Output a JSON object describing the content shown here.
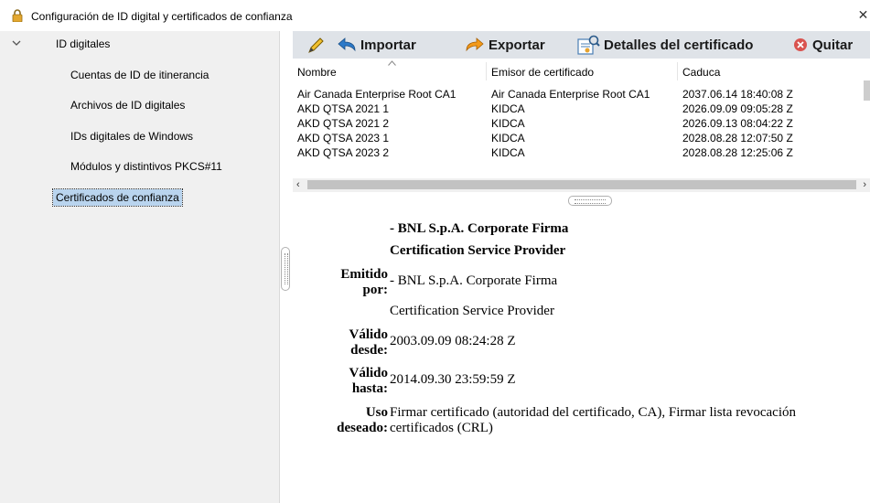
{
  "window": {
    "title": "Configuración de ID digital y certificados de confianza",
    "close_glyph": "✕",
    "icon": "lock-icon"
  },
  "sidebar": {
    "group": "ID digitales",
    "items": [
      "Cuentas de ID de itinerancia",
      "Archivos de ID digitales",
      "IDs digitales de Windows",
      "Módulos y distintivos PKCS#11"
    ],
    "selected": "Certificados de confianza"
  },
  "toolbar": {
    "import_label": "Importar",
    "export_label": "Exportar",
    "details_label": "Detalles del certificado",
    "remove_label": "Quitar"
  },
  "table": {
    "columns": [
      "Nombre",
      "Emisor de certificado",
      "Caduca"
    ],
    "rows": [
      [
        "Air Canada Enterprise Root CA1",
        "Air Canada Enterprise Root CA1",
        "2037.06.14 18:40:08 Z"
      ],
      [
        "AKD QTSA 2021 1",
        "KIDCA",
        "2026.09.09 09:05:28 Z"
      ],
      [
        "AKD QTSA 2021 2",
        "KIDCA",
        "2026.09.13 08:04:22 Z"
      ],
      [
        "AKD QTSA 2023 1",
        "KIDCA",
        "2028.08.28 12:07:50 Z"
      ],
      [
        "AKD QTSA 2023 2",
        "KIDCA",
        "2028.08.28 12:25:06 Z"
      ]
    ],
    "scroll_left": "‹",
    "scroll_right": "›"
  },
  "details": {
    "subject_line1": "- BNL S.p.A. Corporate Firma",
    "subject_line2": "Certification Service Provider",
    "issued_by_label1": "Emitido",
    "issued_by_label2": "por:",
    "issued_by_line1": "- BNL S.p.A. Corporate Firma",
    "issued_by_line2": "Certification Service Provider",
    "valid_from_label1": "Válido",
    "valid_from_label2": "desde:",
    "valid_from": "2003.09.09 08:24:28 Z",
    "valid_to_label1": "Válido",
    "valid_to_label2": "hasta:",
    "valid_to": "2014.09.30 23:59:59 Z",
    "usage_label1": "Uso",
    "usage_label2": "deseado:",
    "usage_line1": "Firmar certificado (autoridad del certificado, CA), Firmar lista revocación",
    "usage_line2": "certificados (CRL)"
  }
}
